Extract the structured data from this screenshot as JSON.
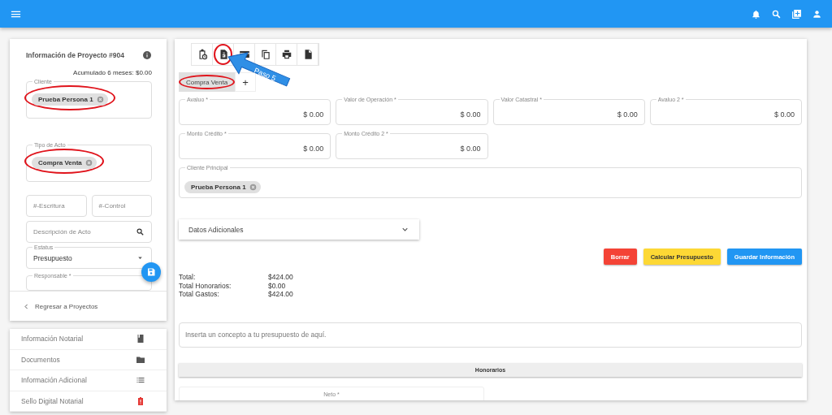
{
  "project_panel": {
    "title": "Información de Proyecto #904",
    "accumulated": "Acumulado 6 meses: $0.00",
    "chip_fields": [
      {
        "label": "Cliente",
        "chips": [
          {
            "text": "Prueba Persona 1",
            "highlighted": true
          }
        ]
      },
      {
        "label": "Tipo de Acto",
        "chips": [
          {
            "text": "Compra Venta",
            "highlighted": true
          }
        ]
      }
    ],
    "escritura": {
      "placeholder": "#-Escritura"
    },
    "control": {
      "placeholder": "#-Control"
    },
    "descripcion": {
      "placeholder": "Descripción de Acto"
    },
    "estatus": {
      "label": "Estatus",
      "value": "Presupuesto"
    },
    "responsable": {
      "label": "Responsable *"
    },
    "back_link": "Regresar a Proyectos"
  },
  "side_menu": [
    {
      "label": "Información Notarial"
    },
    {
      "label": "Documentos"
    },
    {
      "label": "Información Adicional"
    },
    {
      "label": "Sello Digital Notarial"
    }
  ],
  "main": {
    "toolbar": [
      {
        "highlighted": false
      },
      {
        "highlighted": true
      },
      {
        "highlighted": false
      },
      {
        "highlighted": false
      },
      {
        "highlighted": false
      },
      {
        "highlighted": false
      }
    ],
    "callout": "Paso 5",
    "tabs": [
      {
        "label": "Compra Venta",
        "selected": true,
        "highlighted": true
      }
    ],
    "add_tab": "+",
    "amount_fields": [
      {
        "label": "Avaluo *",
        "value": "$ 0.00"
      },
      {
        "label": "Valor de Operación *",
        "value": "$ 0.00"
      },
      {
        "label": "Valor Catastral *",
        "value": "$ 0.00"
      },
      {
        "label": "Avaluo 2 *",
        "value": "$ 0.00"
      },
      {
        "label": "Monto Crédito *",
        "value": "$ 0.00"
      },
      {
        "label": "Monto Crédito 2 *",
        "value": "$ 0.00"
      }
    ],
    "cliente_principal": {
      "label": "Cliente Principal",
      "chips": [
        {
          "text": "Prueba Persona 1",
          "highlighted": false
        }
      ]
    },
    "expansion": {
      "title": "Datos Adicionales",
      "expanded": false
    },
    "buttons": [
      {
        "label": "Borrar",
        "kind": "danger"
      },
      {
        "label": "Calcular Presupuesto",
        "kind": "warning"
      },
      {
        "label": "Guardar Información",
        "kind": "primary"
      }
    ],
    "totals": [
      {
        "label": "Total:",
        "value": "$424.00"
      },
      {
        "label": "Total Honorarios:",
        "value": "$0.00"
      },
      {
        "label": "Total Gastos:",
        "value": "$424.00"
      }
    ],
    "concept": {
      "placeholder": "Inserta un concepto a tu presupuesto de aquí."
    },
    "section_header": "Honorarios",
    "neto": {
      "label": "Neto *"
    }
  }
}
